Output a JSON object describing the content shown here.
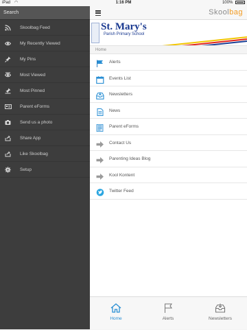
{
  "status_bar": {
    "carrier": "iPad",
    "time": "1:16 PM",
    "battery": "100%"
  },
  "sidebar": {
    "search_label": "Search",
    "items": [
      {
        "label": "Skoolbag Feed",
        "icon": "rss-icon"
      },
      {
        "label": "My Recently Viewed",
        "icon": "eye-icon"
      },
      {
        "label": "My Pins",
        "icon": "pin-icon"
      },
      {
        "label": "Most Viewed",
        "icon": "eye-icon"
      },
      {
        "label": "Most Pinned",
        "icon": "pin-icon"
      },
      {
        "label": "Parent eForms",
        "icon": "id-card-icon"
      },
      {
        "label": "Send us a photo",
        "icon": "camera-icon"
      },
      {
        "label": "Share App",
        "icon": "share-icon"
      },
      {
        "label": "Like Skoolbag",
        "icon": "share-icon"
      },
      {
        "label": "Setup",
        "icon": "gear-icon"
      }
    ]
  },
  "header": {
    "brand_prefix": "Skool",
    "brand_suffix": "bag"
  },
  "school": {
    "name": "St. Mary's",
    "subtitle": "Parish Primary School"
  },
  "breadcrumb": "Home",
  "menu": [
    {
      "label": "Alerts",
      "icon": "flag-icon"
    },
    {
      "label": "Events List",
      "icon": "calendar-icon"
    },
    {
      "label": "Newsletters",
      "icon": "inbox-icon"
    },
    {
      "label": "News",
      "icon": "document-icon"
    },
    {
      "label": "Parent eForms",
      "icon": "form-icon"
    },
    {
      "label": "Contact Us",
      "icon": "arrow-icon"
    },
    {
      "label": "Parenting Ideas Blog",
      "icon": "arrow-icon"
    },
    {
      "label": "Kool Kontent",
      "icon": "arrow-icon"
    },
    {
      "label": "Twitter Feed",
      "icon": "twitter-icon"
    }
  ],
  "tabs": [
    {
      "label": "Home",
      "icon": "home-icon",
      "active": true
    },
    {
      "label": "Alerts",
      "icon": "flag-icon",
      "active": false
    },
    {
      "label": "Newsletters",
      "icon": "inbox-icon",
      "active": false
    }
  ],
  "colors": {
    "accent": "#2a8fd4",
    "sidebar_bg": "#3d3d3d",
    "school_blue": "#17378f",
    "brand_orange": "#f29a1f"
  }
}
